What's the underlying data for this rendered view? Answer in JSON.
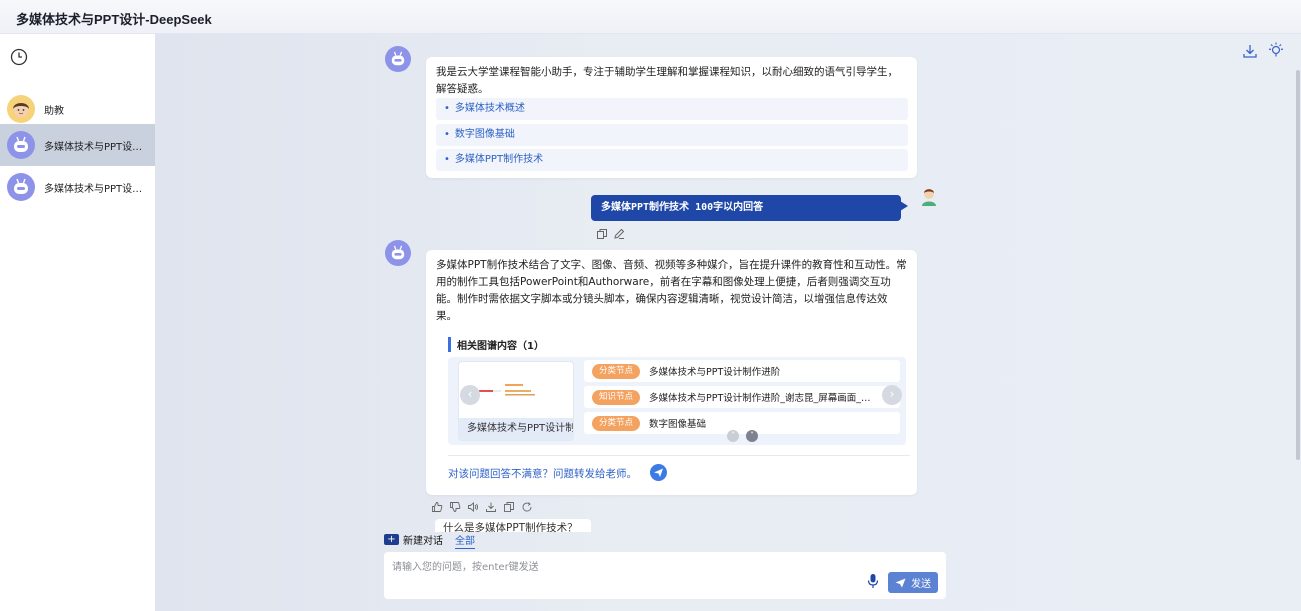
{
  "app": {
    "title": "多媒体技术与PPT设计-DeepSeek"
  },
  "sidebar": {
    "items": [
      {
        "label": "助教",
        "icon": "teacher-avatar-icon",
        "active": false
      },
      {
        "label": "多媒体技术与PPT设计-DeepSeek",
        "icon": "robot-avatar-icon",
        "active": true
      },
      {
        "label": "多媒体技术与PPT设计-DeepSeek",
        "icon": "robot-avatar-icon",
        "active": false
      }
    ]
  },
  "chat": {
    "intro": {
      "text": "我是云大学堂课程智能小助手，专注于辅助学生理解和掌握课程知识，以耐心细致的语气引导学生，解答疑惑。",
      "suggestions": [
        "多媒体技术概述",
        "数字图像基础",
        "多媒体PPT制作技术"
      ]
    },
    "user_message": "多媒体PPT制作技术 100字以内回答",
    "answer": {
      "text": "多媒体PPT制作技术结合了文字、图像、音频、视频等多种媒介，旨在提升课件的教育性和互动性。常用的制作工具包括PowerPoint和Authorware，前者在字幕和图像处理上便捷，后者则强调交互功能。制作时需依据文字脚本或分镜头脚本，确保内容逻辑清晰，视觉设计简洁，以增强信息传达效果。",
      "graph_section_title": "相关图谱内容（1）",
      "graph_card_caption": "多媒体技术与PPT设计制作进阶",
      "nodes": [
        {
          "tag": "分类节点",
          "text": "多媒体技术与PPT设计制作进阶"
        },
        {
          "tag": "知识节点",
          "text": "多媒体技术与PPT设计制作进阶_谢志昆_屏幕画面_录屏课件"
        },
        {
          "tag": "分类节点",
          "text": "数字图像基础"
        }
      ],
      "feedback_text": "对该问题回答不满意？问题转发给老师。"
    },
    "suggested_question": "什么是多媒体PPT制作技术？"
  },
  "composer": {
    "new_chat_label": "新建对话",
    "filter_label": "全部",
    "placeholder": "请输入您的问题，按enter键发送",
    "value": "",
    "send_label": "发送"
  },
  "colors": {
    "accent": "#1f47a8",
    "link": "#2e62c7",
    "tag_orange": "#f4a25f",
    "bot_purple": "#8d93e8",
    "sidebar_active": "#c9d1de"
  }
}
